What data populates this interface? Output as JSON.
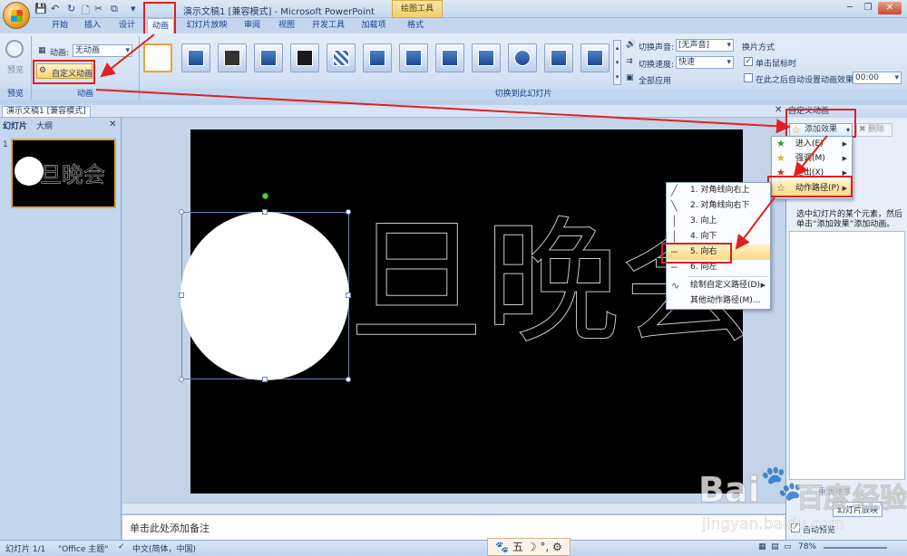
{
  "window": {
    "title": "演示文稿1 [兼容模式] - Microsoft PowerPoint",
    "contextual_tab": "绘图工具"
  },
  "tabs": [
    "开始",
    "插入",
    "设计",
    "动画",
    "幻灯片放映",
    "审阅",
    "视图",
    "开发工具",
    "加载项",
    "格式"
  ],
  "ribbon": {
    "preview_label": "预览",
    "preview_group": "预览",
    "animation_label": "动画:",
    "animation_value": "无动画",
    "custom_animation_label": "自定义动画",
    "animation_group": "动画",
    "transition_group": "切换到此幻灯片",
    "sound_label": "切换声音:",
    "sound_value": "[无声音]",
    "speed_label": "切换速度:",
    "speed_value": "快速",
    "apply_all_label": "全部应用",
    "advance_title": "换片方式",
    "on_click_label": "单击鼠标时",
    "auto_after_label": "在此之后自动设置动画效果:",
    "auto_after_value": "00:00"
  },
  "document": {
    "tab_label": "演示文稿1 [兼容模式]",
    "pane_tab_slides": "幻灯片",
    "pane_tab_outline": "大纲",
    "slide_number": "1",
    "slide_text": "旦晚会",
    "notes_placeholder": "单击此处添加备注"
  },
  "taskpane": {
    "title": "自定义动画",
    "add_effect_label": "添加效果",
    "remove_label": "删除",
    "hint": "选中幻灯片的某个元素，然后单击“添加效果”添加动画。",
    "reorder_label": "重新排序",
    "slideshow_label": "幻灯片放映",
    "autopreview_label": "自动预览"
  },
  "menu_add_effect": {
    "items": [
      {
        "label": "进入(E)",
        "icon": "star-green-icon"
      },
      {
        "label": "强调(M)",
        "icon": "star-yellow-icon"
      },
      {
        "label": "退出(X)",
        "icon": "star-red-icon"
      },
      {
        "label": "动作路径(P)",
        "icon": "star-outline-icon"
      }
    ]
  },
  "menu_paths": {
    "items": [
      {
        "label": "1. 对角线向右上",
        "icon": "diagonal-up-icon"
      },
      {
        "label": "2. 对角线向右下",
        "icon": "diagonal-down-icon"
      },
      {
        "label": "3. 向上",
        "icon": "line-up-icon"
      },
      {
        "label": "4. 向下",
        "icon": "line-down-icon"
      },
      {
        "label": "5. 向右",
        "icon": "line-right-icon"
      },
      {
        "label": "6. 向左",
        "icon": "line-left-icon"
      },
      {
        "label": "绘制自定义路径(D)",
        "icon": "custom-path-icon"
      },
      {
        "label": "其他动作路径(M)...",
        "icon": ""
      }
    ]
  },
  "statusbar": {
    "slide_info": "幻灯片 1/1",
    "theme": "\"Office 主题\"",
    "language": "中文(简体，中国)",
    "zoom": "78%"
  },
  "watermark": {
    "brand": "Bai",
    "brand2": "百度",
    "brand3": "经验",
    "url": "jingyan.baidu.com"
  }
}
